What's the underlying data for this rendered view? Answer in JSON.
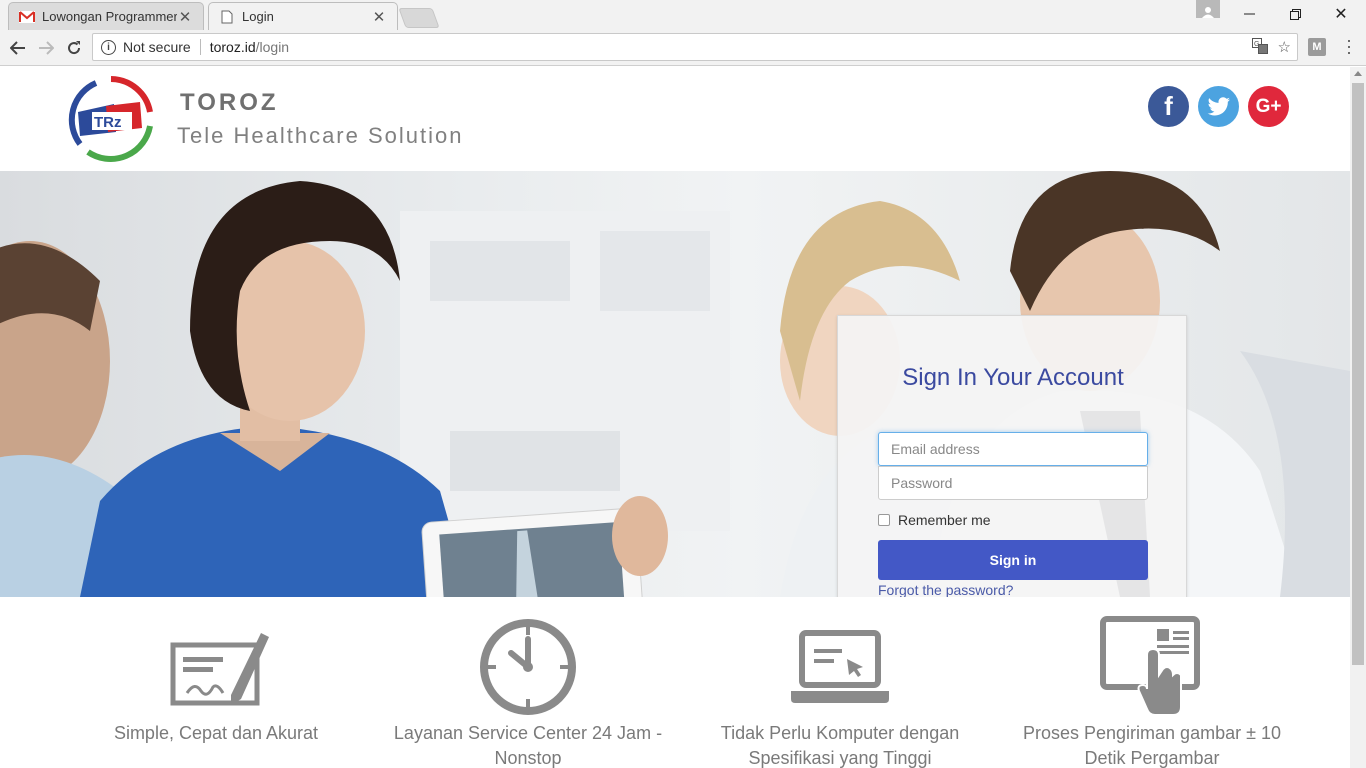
{
  "browser": {
    "tabs": [
      {
        "title": "Lowongan Programmer F",
        "icon": "gmail-icon"
      },
      {
        "title": "Login",
        "icon": "page-icon"
      }
    ],
    "address": {
      "security": "Not secure",
      "host": "toroz.id",
      "path": "/login"
    },
    "extension_label": "M"
  },
  "header": {
    "logo_text": "TRz",
    "brand_name": "TOROZ",
    "tagline": "Tele Healthcare Solution",
    "social": [
      {
        "name": "facebook",
        "glyph": "f",
        "color": "#3b5998"
      },
      {
        "name": "twitter",
        "color": "#4ca3e0"
      },
      {
        "name": "google-plus",
        "glyph": "G+",
        "color": "#e0283c"
      }
    ]
  },
  "login": {
    "title": "Sign In Your Account",
    "email_placeholder": "Email address",
    "password_placeholder": "Password",
    "remember_label": "Remember me",
    "submit_label": "Sign in",
    "forgot_label": "Forgot the password?",
    "accent_color": "#4358c6"
  },
  "features": [
    {
      "icon": "signature-certificate-icon",
      "text": "Simple, Cepat dan Akurat"
    },
    {
      "icon": "clock-icon",
      "text": "Layanan Service Center 24 Jam - Nonstop"
    },
    {
      "icon": "laptop-icon",
      "text": "Tidak Perlu Komputer dengan Spesifikasi yang Tinggi"
    },
    {
      "icon": "touch-screen-icon",
      "text": "Proses Pengiriman gambar ± 10 Detik Pergambar"
    }
  ]
}
